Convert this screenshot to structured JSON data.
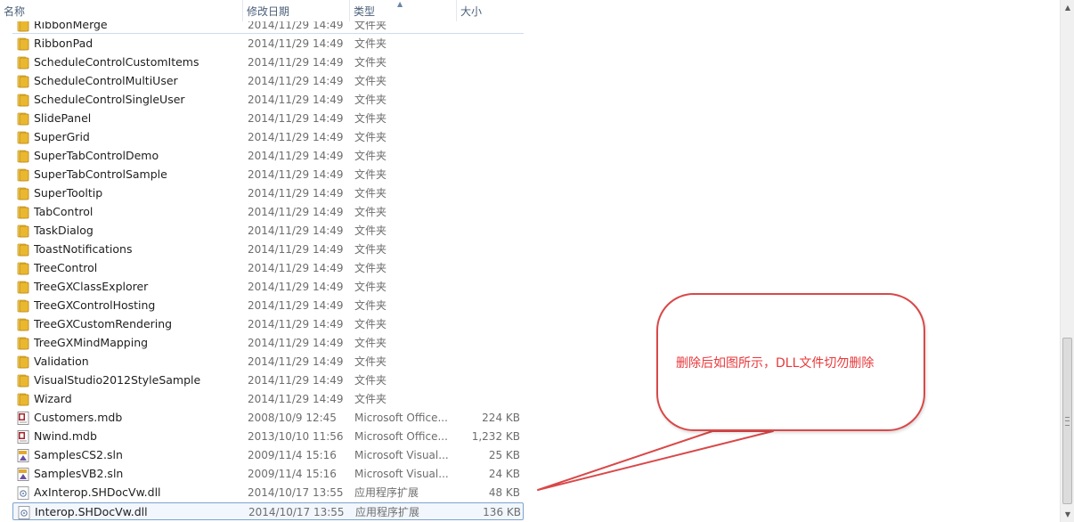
{
  "columns": {
    "name": "名称",
    "date": "修改日期",
    "type": "类型",
    "size": "大小"
  },
  "files": [
    {
      "name": "RibbonMerge",
      "date": "2014/11/29 14:49",
      "type": "文件夹",
      "size": "",
      "icon": "folder-icon"
    },
    {
      "name": "RibbonPad",
      "date": "2014/11/29 14:49",
      "type": "文件夹",
      "size": "",
      "icon": "folder-icon"
    },
    {
      "name": "ScheduleControlCustomItems",
      "date": "2014/11/29 14:49",
      "type": "文件夹",
      "size": "",
      "icon": "folder-icon"
    },
    {
      "name": "ScheduleControlMultiUser",
      "date": "2014/11/29 14:49",
      "type": "文件夹",
      "size": "",
      "icon": "folder-icon"
    },
    {
      "name": "ScheduleControlSingleUser",
      "date": "2014/11/29 14:49",
      "type": "文件夹",
      "size": "",
      "icon": "folder-icon"
    },
    {
      "name": "SlidePanel",
      "date": "2014/11/29 14:49",
      "type": "文件夹",
      "size": "",
      "icon": "folder-icon"
    },
    {
      "name": "SuperGrid",
      "date": "2014/11/29 14:49",
      "type": "文件夹",
      "size": "",
      "icon": "folder-icon"
    },
    {
      "name": "SuperTabControlDemo",
      "date": "2014/11/29 14:49",
      "type": "文件夹",
      "size": "",
      "icon": "folder-icon"
    },
    {
      "name": "SuperTabControlSample",
      "date": "2014/11/29 14:49",
      "type": "文件夹",
      "size": "",
      "icon": "folder-icon"
    },
    {
      "name": "SuperTooltip",
      "date": "2014/11/29 14:49",
      "type": "文件夹",
      "size": "",
      "icon": "folder-icon"
    },
    {
      "name": "TabControl",
      "date": "2014/11/29 14:49",
      "type": "文件夹",
      "size": "",
      "icon": "folder-icon"
    },
    {
      "name": "TaskDialog",
      "date": "2014/11/29 14:49",
      "type": "文件夹",
      "size": "",
      "icon": "folder-icon"
    },
    {
      "name": "ToastNotifications",
      "date": "2014/11/29 14:49",
      "type": "文件夹",
      "size": "",
      "icon": "folder-icon"
    },
    {
      "name": "TreeControl",
      "date": "2014/11/29 14:49",
      "type": "文件夹",
      "size": "",
      "icon": "folder-icon"
    },
    {
      "name": "TreeGXClassExplorer",
      "date": "2014/11/29 14:49",
      "type": "文件夹",
      "size": "",
      "icon": "folder-icon"
    },
    {
      "name": "TreeGXControlHosting",
      "date": "2014/11/29 14:49",
      "type": "文件夹",
      "size": "",
      "icon": "folder-icon"
    },
    {
      "name": "TreeGXCustomRendering",
      "date": "2014/11/29 14:49",
      "type": "文件夹",
      "size": "",
      "icon": "folder-icon"
    },
    {
      "name": "TreeGXMindMapping",
      "date": "2014/11/29 14:49",
      "type": "文件夹",
      "size": "",
      "icon": "folder-icon"
    },
    {
      "name": "Validation",
      "date": "2014/11/29 14:49",
      "type": "文件夹",
      "size": "",
      "icon": "folder-icon"
    },
    {
      "name": "VisualStudio2012StyleSample",
      "date": "2014/11/29 14:49",
      "type": "文件夹",
      "size": "",
      "icon": "folder-icon"
    },
    {
      "name": "Wizard",
      "date": "2014/11/29 14:49",
      "type": "文件夹",
      "size": "",
      "icon": "folder-icon"
    },
    {
      "name": "Customers.mdb",
      "date": "2008/10/9 12:45",
      "type": "Microsoft Office...",
      "size": "224 KB",
      "icon": "access-database-icon"
    },
    {
      "name": "Nwind.mdb",
      "date": "2013/10/10 11:56",
      "type": "Microsoft Office...",
      "size": "1,232 KB",
      "icon": "access-database-icon"
    },
    {
      "name": "SamplesCS2.sln",
      "date": "2009/11/4 15:16",
      "type": "Microsoft Visual...",
      "size": "25 KB",
      "icon": "visual-studio-solution-icon"
    },
    {
      "name": "SamplesVB2.sln",
      "date": "2009/11/4 15:16",
      "type": "Microsoft Visual...",
      "size": "24 KB",
      "icon": "visual-studio-solution-icon"
    },
    {
      "name": "AxInterop.SHDocVw.dll",
      "date": "2014/10/17 13:55",
      "type": "应用程序扩展",
      "size": "48 KB",
      "icon": "dll-file-icon"
    },
    {
      "name": "Interop.SHDocVw.dll",
      "date": "2014/10/17 13:55",
      "type": "应用程序扩展",
      "size": "136 KB",
      "icon": "dll-file-icon",
      "selected": true
    }
  ],
  "annotation": {
    "text": "删除后如图所示，DLL文件切勿删除",
    "color": "#e8383b"
  },
  "colors": {
    "folder": "#e8b631",
    "selection_border": "#7da2ce",
    "header_text": "#4c607a"
  }
}
